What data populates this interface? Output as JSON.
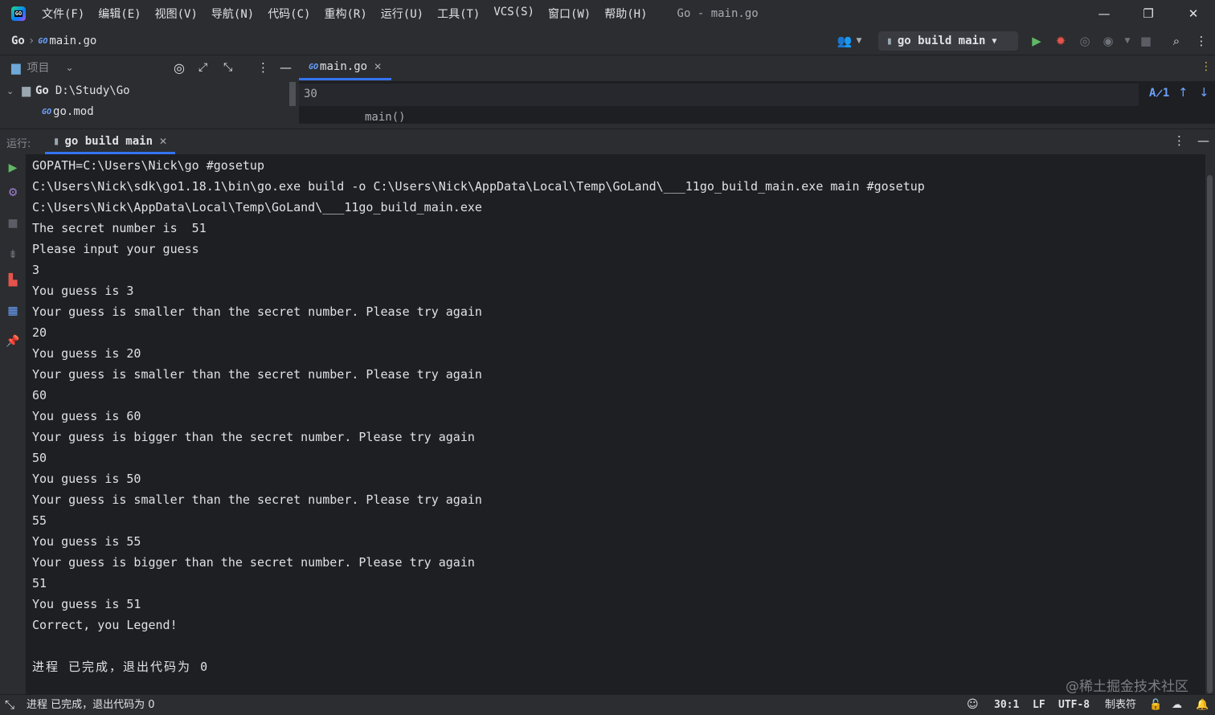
{
  "menu": [
    "文件(F)",
    "编辑(E)",
    "视图(V)",
    "导航(N)",
    "代码(C)",
    "重构(R)",
    "运行(U)",
    "工具(T)",
    "VCS(S)",
    "窗口(W)",
    "帮助(H)"
  ],
  "window_title": "Go - main.go",
  "logo_text": "GO",
  "breadcrumb": {
    "project": "Go",
    "separator": "›",
    "file": "main.go"
  },
  "run_config": {
    "label": "go build main"
  },
  "project_panel": {
    "title": "项目",
    "root_name": "Go",
    "root_path": "D:\\Study\\Go",
    "file": "go.mod"
  },
  "editor": {
    "tab_label": "main.go",
    "line_number": "30",
    "breadcrumb_func": "main()",
    "inspection_count": "1"
  },
  "run_panel": {
    "label": "运行:",
    "tab_label": "go build main"
  },
  "console_lines": [
    "GOPATH=C:\\Users\\Nick\\go #gosetup",
    "C:\\Users\\Nick\\sdk\\go1.18.1\\bin\\go.exe build -o C:\\Users\\Nick\\AppData\\Local\\Temp\\GoLand\\___11go_build_main.exe main #gosetup",
    "C:\\Users\\Nick\\AppData\\Local\\Temp\\GoLand\\___11go_build_main.exe",
    "The secret number is  51",
    "Please input your guess",
    "3",
    "You guess is 3",
    "Your guess is smaller than the secret number. Please try again",
    "20",
    "You guess is 20",
    "Your guess is smaller than the secret number. Please try again",
    "60",
    "You guess is 60",
    "Your guess is bigger than the secret number. Please try again",
    "50",
    "You guess is 50",
    "Your guess is smaller than the secret number. Please try again",
    "55",
    "You guess is 55",
    "Your guess is bigger than the secret number. Please try again",
    "51",
    "You guess is 51",
    "Correct, you Legend!"
  ],
  "exit_message": "进程 已完成，退出代码为 0",
  "status": {
    "message": "进程 已完成，退出代码为 0",
    "position": "30:1",
    "line_ending": "LF",
    "encoding": "UTF-8",
    "indent": "制表符"
  },
  "watermark": "@稀土掘金技术社区",
  "colors": {
    "accent": "#3574f0",
    "run_green": "#5fb865",
    "debug_red": "#e5534b",
    "bg_console": "#1e1f22",
    "bg_panel": "#2b2d30"
  }
}
